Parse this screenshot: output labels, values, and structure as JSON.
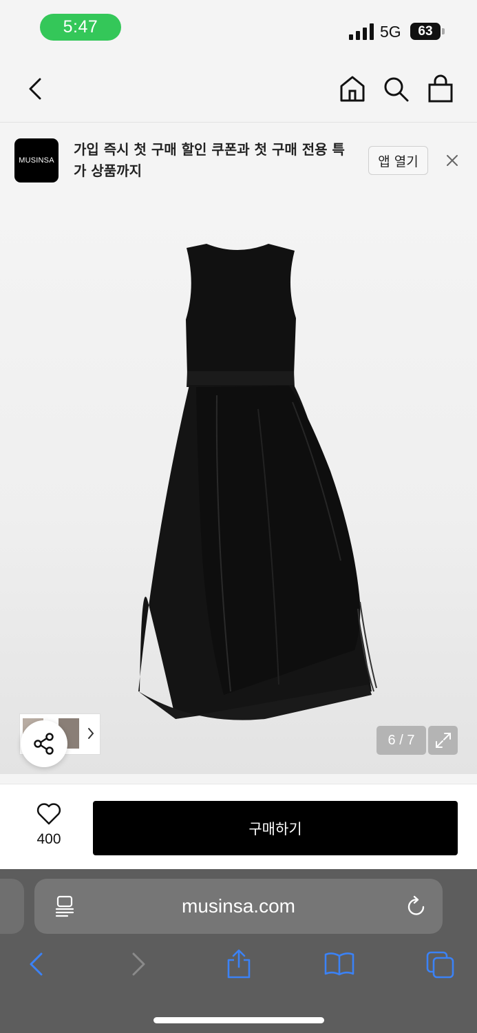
{
  "status_bar": {
    "time": "5:47",
    "network": "5G",
    "battery": "63"
  },
  "nav": {},
  "banner": {
    "logo_text": "MUSINSA",
    "message": "가입 즉시 첫 구매 할인 쿠폰과 첫 구매 전용 특가 상품까지",
    "open_app_label": "앱 열기"
  },
  "gallery": {
    "counter": "6 / 7"
  },
  "buy_bar": {
    "like_count": "400",
    "buy_label": "구매하기"
  },
  "browser": {
    "url": "musinsa.com"
  },
  "colors": {
    "status_pill": "#34c759",
    "buy_button": "#000000",
    "safari_link": "#3b82f6"
  }
}
